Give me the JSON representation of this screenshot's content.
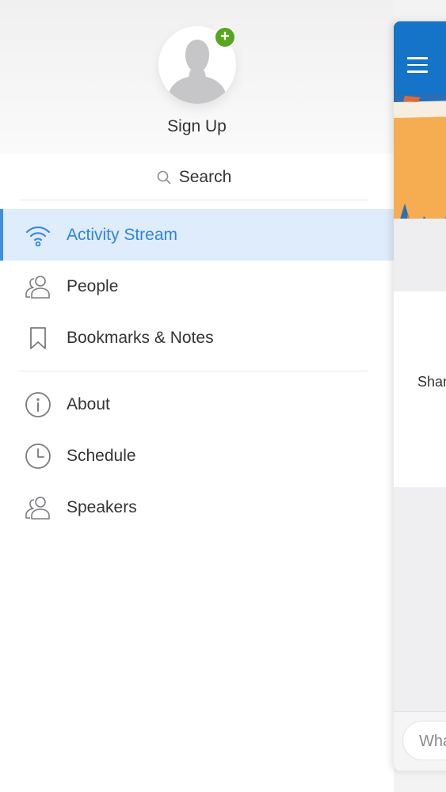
{
  "drawer": {
    "profile": {
      "sign_up_label": "Sign Up"
    },
    "search": {
      "label": "Search"
    },
    "primary_items": [
      {
        "label": "Activity Stream",
        "icon": "wifi-icon",
        "active": true
      },
      {
        "label": "People",
        "icon": "people-icon"
      },
      {
        "label": "Bookmarks & Notes",
        "icon": "bookmark-icon"
      }
    ],
    "secondary_items": [
      {
        "label": "About",
        "icon": "info-icon"
      },
      {
        "label": "Schedule",
        "icon": "clock-icon"
      },
      {
        "label": "Speakers",
        "icon": "speaker-icon"
      }
    ]
  },
  "main_panel": {
    "card_text": "Shar",
    "compose_placeholder": "Wha"
  },
  "colors": {
    "accent": "#2e85df",
    "active_background": "#deecfb",
    "header_blue": "#1573c8",
    "plus_badge": "#5aa51f"
  }
}
